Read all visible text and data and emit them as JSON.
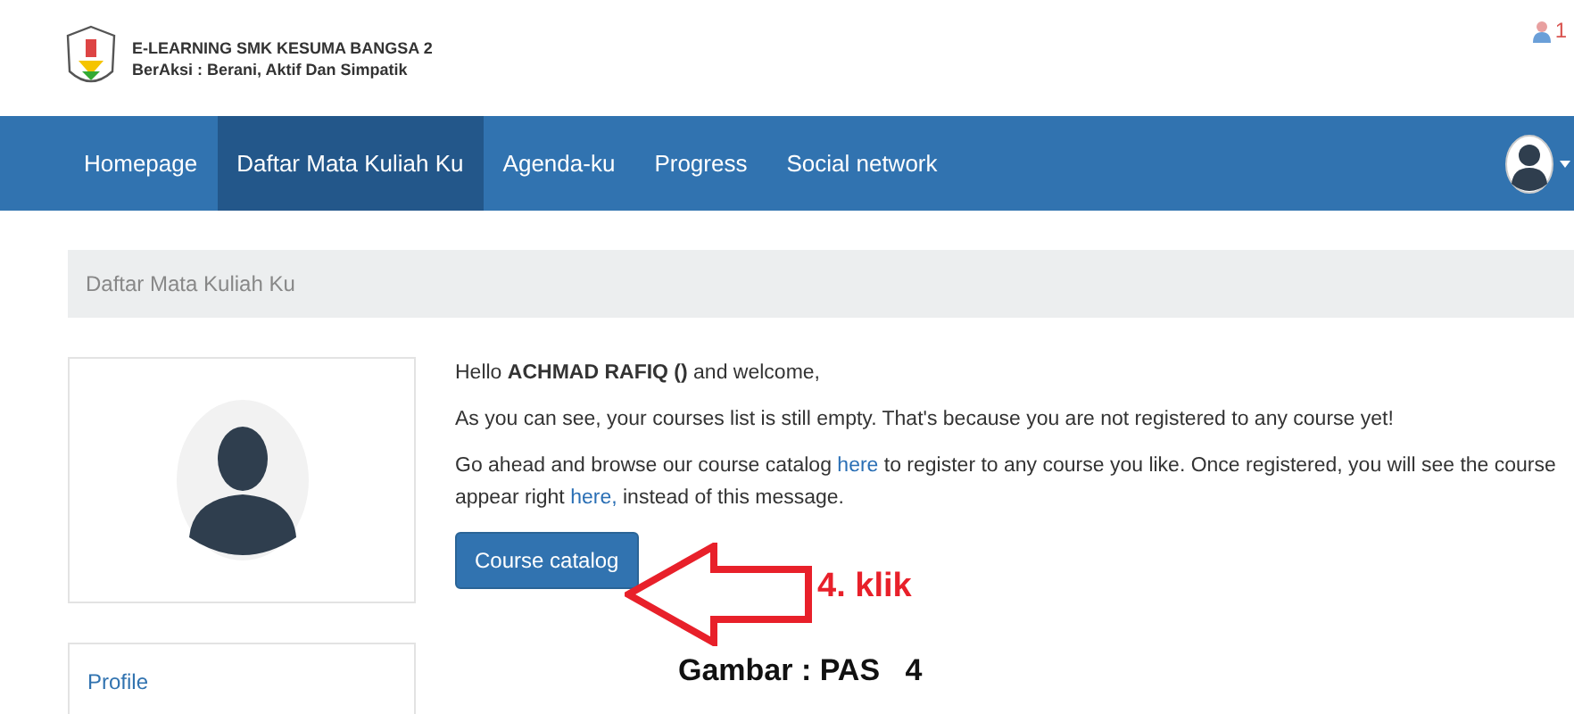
{
  "header": {
    "title": "E-LEARNING SMK KESUMA BANGSA 2",
    "motto": "BerAksi : Berani, Aktif Dan Simpatik",
    "notification_count": "1"
  },
  "nav": [
    {
      "label": "Homepage",
      "selected": false
    },
    {
      "label": "Daftar Mata Kuliah Ku",
      "selected": true
    },
    {
      "label": "Agenda-ku",
      "selected": false
    },
    {
      "label": "Progress",
      "selected": false
    },
    {
      "label": "Social network",
      "selected": false
    }
  ],
  "breadcrumb": "Daftar Mata Kuliah Ku",
  "sidebar": {
    "panel_title": "Profile"
  },
  "content": {
    "greeting": "Hello **ACHMAD RAFIQ ()** and welcome,",
    "empty_notice": "As you can see, your courses list is still empty. That's because you are not registered to any course yet!",
    "browse_parts": [
      {
        "kind": "text",
        "text": "Go ahead and browse our course catalog "
      },
      {
        "kind": "link",
        "text": "here"
      },
      {
        "kind": "text",
        "text": " to register to any course you like. Once registered, you will see the course appear right "
      },
      {
        "kind": "link",
        "text": "here,"
      },
      {
        "kind": "text",
        "text": " instead of this message."
      }
    ],
    "button": "Course catalog"
  },
  "annotations": {
    "step": "4. klik",
    "caption": "Gambar : PAS   4"
  }
}
